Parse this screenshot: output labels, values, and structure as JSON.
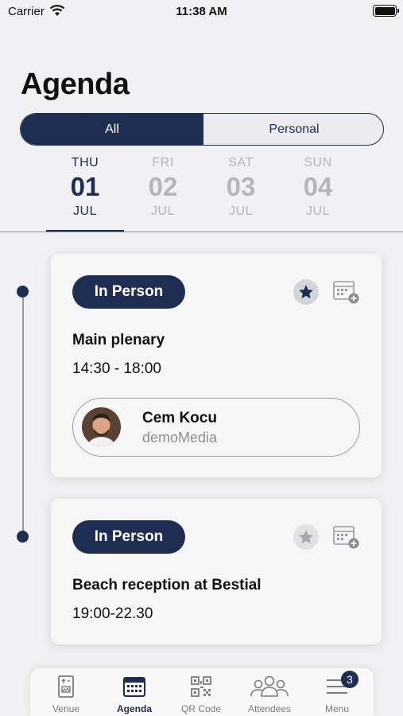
{
  "status_bar": {
    "carrier": "Carrier",
    "time": "11:38 AM"
  },
  "page": {
    "title": "Agenda"
  },
  "filter": {
    "options": [
      "All",
      "Personal"
    ],
    "selected": "All"
  },
  "dates": [
    {
      "dow": "THU",
      "day": "01",
      "month": "JUL",
      "active": true
    },
    {
      "dow": "FRI",
      "day": "02",
      "month": "JUL",
      "active": false
    },
    {
      "dow": "SAT",
      "day": "03",
      "month": "JUL",
      "active": false
    },
    {
      "dow": "SUN",
      "day": "04",
      "month": "JUL",
      "active": false
    }
  ],
  "sessions": [
    {
      "badge": "In Person",
      "title": "Main plenary",
      "time": "14:30 - 18:00",
      "starred": true,
      "speaker": {
        "name": "Cem Kocu",
        "organization": "demoMedia"
      }
    },
    {
      "badge": "In Person",
      "title": "Beach reception at Bestial",
      "time": "19:00-22.30",
      "starred": false
    }
  ],
  "tabbar": {
    "items": [
      {
        "label": "Venue",
        "icon": "venue-icon"
      },
      {
        "label": "Agenda",
        "icon": "calendar-icon",
        "active": true
      },
      {
        "label": "QR Code",
        "icon": "qr-code-icon"
      },
      {
        "label": "Attendees",
        "icon": "attendees-icon"
      },
      {
        "label": "Menu",
        "icon": "menu-icon",
        "badge": "3"
      }
    ]
  },
  "colors": {
    "primary": "#1f2d52",
    "background": "#f1f1f3",
    "inactive": "#b6b6ba"
  }
}
